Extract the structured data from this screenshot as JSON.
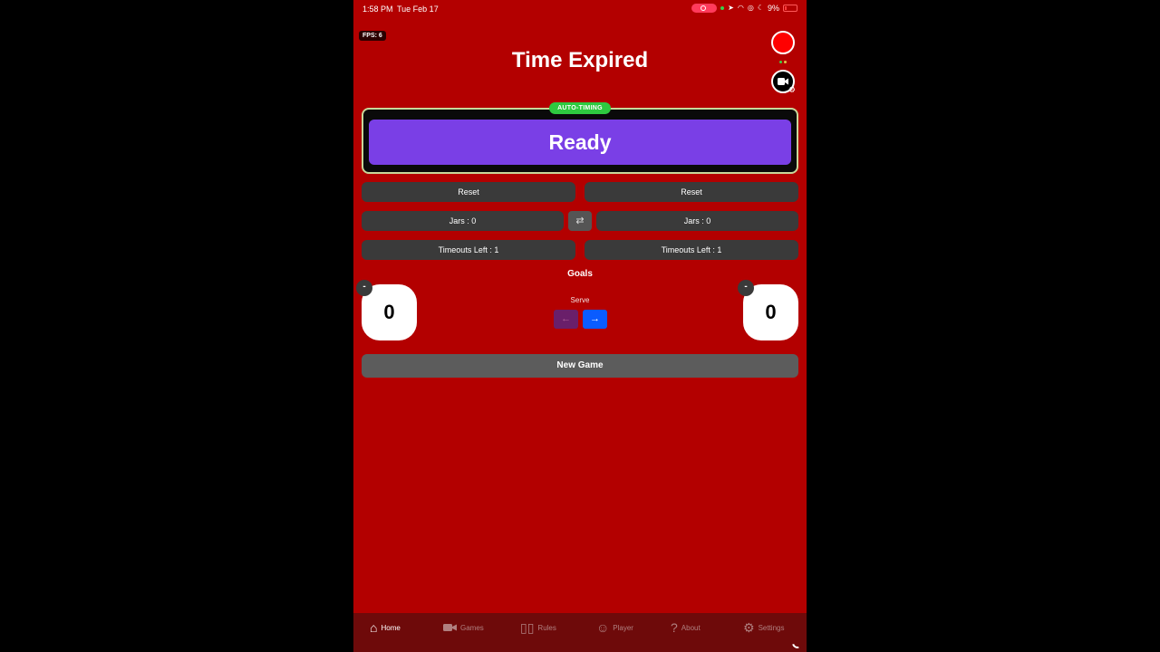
{
  "status_bar": {
    "time": "1:58 PM",
    "date": "Tue Feb 17",
    "battery": "9%"
  },
  "fps": "FPS: 6",
  "title": "Time Expired",
  "timer": {
    "badge": "AUTO-TIMING",
    "state": "Ready"
  },
  "left_team": {
    "reset": "Reset",
    "jars": "Jars : 0",
    "timeouts": "Timeouts Left : 1",
    "score": "0"
  },
  "right_team": {
    "reset": "Reset",
    "jars": "Jars : 0",
    "timeouts": "Timeouts Left : 1",
    "score": "0"
  },
  "swap_glyph": "⇄",
  "goals_label": "Goals",
  "minus_glyph": "-",
  "serve": {
    "label": "Serve",
    "left_arrow": "←",
    "right_arrow": "→"
  },
  "new_game": "New Game",
  "tabs": [
    {
      "label": "Home",
      "icon": "home-icon"
    },
    {
      "label": "Games",
      "icon": "video-icon"
    },
    {
      "label": "Rules",
      "icon": "book-icon"
    },
    {
      "label": "Player",
      "icon": "person-icon"
    },
    {
      "label": "About",
      "icon": "question-icon"
    },
    {
      "label": "Settings",
      "icon": "gear-icon"
    }
  ],
  "colors": {
    "background": "#b30000",
    "ready": "#7a3fe6",
    "auto_timing": "#2ec940",
    "record": "#ff0000",
    "serve_active": "#0a5cff",
    "serve_inactive": "#6a1f6a"
  }
}
